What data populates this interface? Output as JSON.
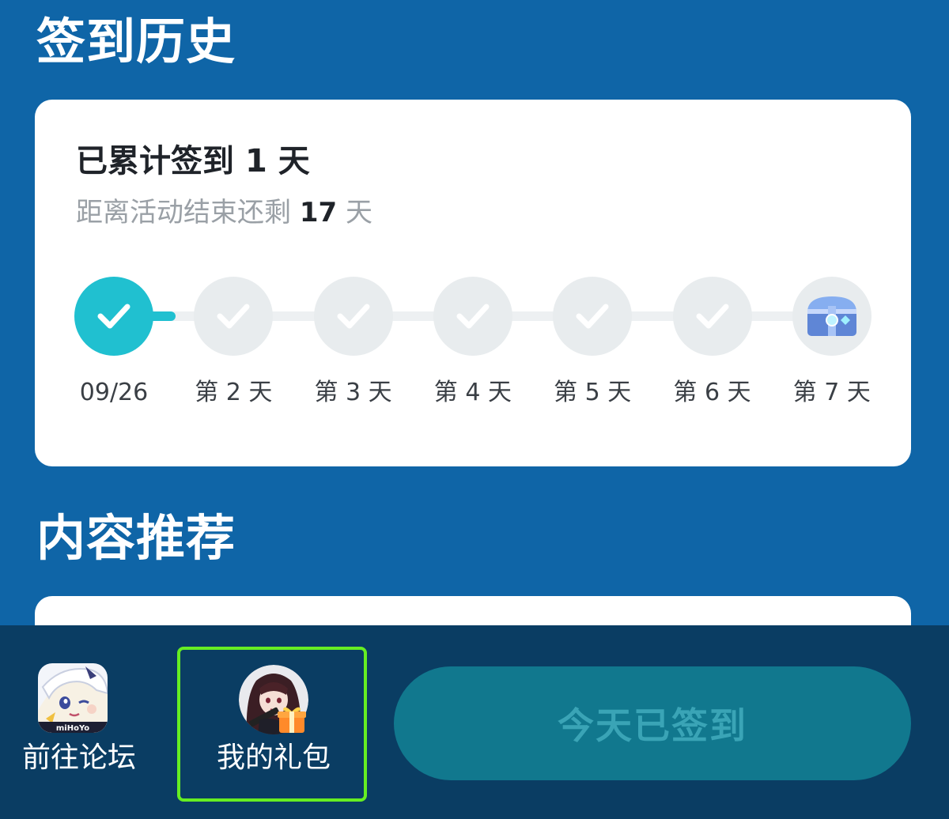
{
  "sections": {
    "history_title": "签到历史",
    "recommend_title": "内容推荐"
  },
  "summary": {
    "accumulated_prefix": "已累计签到 ",
    "accumulated_days": "1",
    "accumulated_suffix": " 天",
    "remaining_prefix": "距离活动结束还剩 ",
    "remaining_days": "17",
    "remaining_suffix": " 天"
  },
  "progress": {
    "completed_days": 1,
    "total_days": 7,
    "days": [
      {
        "label": "09/26",
        "state": "done",
        "icon": "check-icon"
      },
      {
        "label": "第 2 天",
        "state": "pending",
        "icon": "check-icon"
      },
      {
        "label": "第 3 天",
        "state": "pending",
        "icon": "check-icon"
      },
      {
        "label": "第 4 天",
        "state": "pending",
        "icon": "check-icon"
      },
      {
        "label": "第 5 天",
        "state": "pending",
        "icon": "check-icon"
      },
      {
        "label": "第 6 天",
        "state": "pending",
        "icon": "check-icon"
      },
      {
        "label": "第 7 天",
        "state": "reward",
        "icon": "treasure-chest-icon"
      }
    ]
  },
  "bottom_bar": {
    "forum_label": "前往论坛",
    "forum_icon": "mihoyo-forum-app-icon",
    "gift_label": "我的礼包",
    "gift_icon": "character-avatar-with-gift-icon",
    "signed_button_label": "今天已签到"
  },
  "colors": {
    "background": "#0f65a7",
    "accent": "#20c0d0",
    "bottom_bar": "#0a3d63",
    "selection_outline": "#66ee22"
  }
}
